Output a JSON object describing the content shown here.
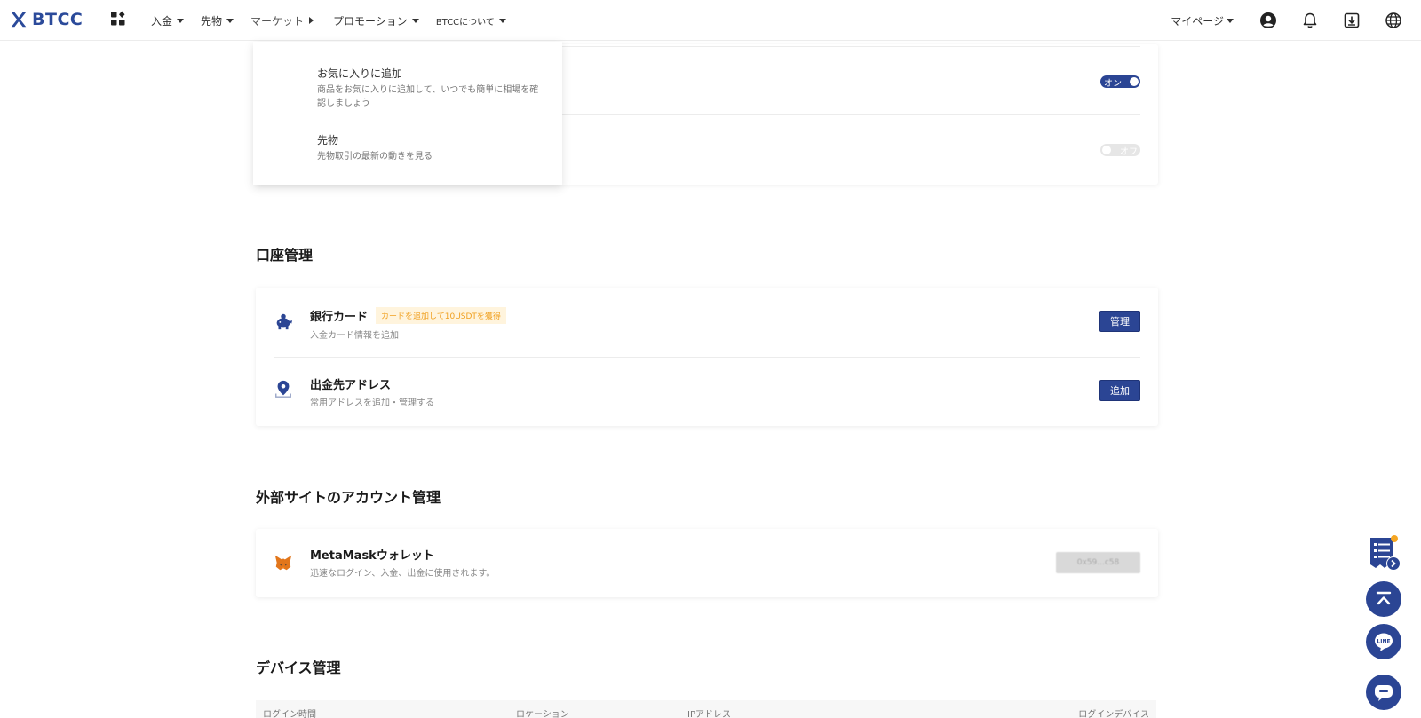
{
  "header": {
    "logo_text": "BTCC",
    "nav": [
      {
        "label": "入金"
      },
      {
        "label": "先物"
      },
      {
        "label": "マーケット"
      },
      {
        "label": "プロモーション"
      },
      {
        "label": "BTCCについて"
      }
    ],
    "mypage": "マイページ",
    "icons": [
      "apps-icon",
      "user-icon",
      "bell-icon",
      "download-icon",
      "globe-icon"
    ]
  },
  "market_dropdown": {
    "items": [
      {
        "title": "お気に入りに追加",
        "desc": "商品をお気に入りに追加して、いつでも簡単に相場を確認しましょう"
      },
      {
        "title": "先物",
        "desc": "先物取引の最新の動きを見る"
      }
    ]
  },
  "settings_card": {
    "rows": [
      {
        "toggle_label": "オン",
        "state": "on"
      },
      {
        "toggle_label": "オフ",
        "state": "off"
      }
    ]
  },
  "account": {
    "title": "口座管理",
    "bank": {
      "title": "銀行カード",
      "tag": "カードを追加して10USDTを獲得",
      "desc": "入金カード情報を追加",
      "button": "管理"
    },
    "address": {
      "title": "出金先アドレス",
      "desc": "常用アドレスを追加・管理する",
      "button": "追加"
    }
  },
  "external": {
    "title": "外部サイトのアカウント管理",
    "metamask": {
      "title": "MetaMaskウォレット",
      "desc": "迅速なログイン、入金、出金に使用されます。",
      "button": "0x59...c58"
    }
  },
  "devices": {
    "title": "デバイス管理",
    "columns": [
      "ログイン時間",
      "ロケーション",
      "IPアドレス",
      "ログインデバイス"
    ]
  },
  "colors": {
    "brand": "#2b4594",
    "tag_bg": "#fff4dd",
    "tag_text": "#f0a020"
  }
}
